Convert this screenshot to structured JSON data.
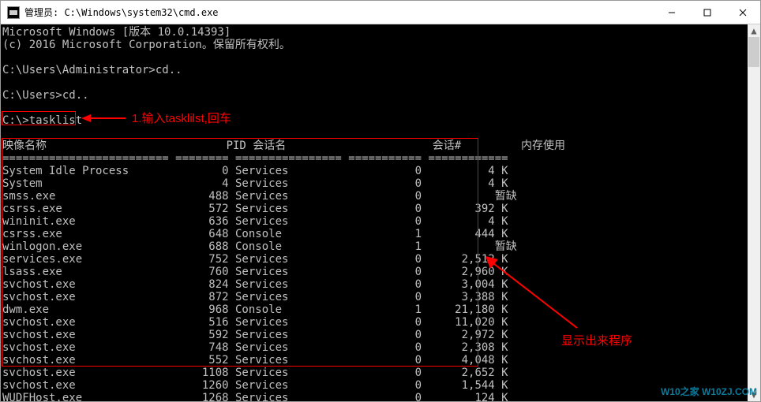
{
  "titlebar": {
    "title": "管理员: C:\\Windows\\system32\\cmd.exe"
  },
  "header_lines": [
    "Microsoft Windows [版本 10.0.14393]",
    "(c) 2016 Microsoft Corporation。保留所有权利。",
    "",
    "C:\\Users\\Administrator>cd..",
    "",
    "C:\\Users>cd..",
    "",
    "C:\\>tasklist",
    ""
  ],
  "table": {
    "headers": {
      "c1": "映像名称",
      "c2": "PID",
      "c3": "会话名",
      "c4": "会话#",
      "c5": "内存使用"
    },
    "sep": {
      "c1": "=========================",
      "c2": "========",
      "c3": "================",
      "c4": "===========",
      "c5": "============"
    },
    "rows": [
      {
        "name": "System Idle Process",
        "pid": "0",
        "sess": "Services",
        "sid": "0",
        "mem": "4 K"
      },
      {
        "name": "System",
        "pid": "4",
        "sess": "Services",
        "sid": "0",
        "mem": "4 K"
      },
      {
        "name": "smss.exe",
        "pid": "488",
        "sess": "Services",
        "sid": "0",
        "mem": "暂缺"
      },
      {
        "name": "csrss.exe",
        "pid": "572",
        "sess": "Services",
        "sid": "0",
        "mem": "392 K"
      },
      {
        "name": "wininit.exe",
        "pid": "636",
        "sess": "Services",
        "sid": "0",
        "mem": "4 K"
      },
      {
        "name": "csrss.exe",
        "pid": "648",
        "sess": "Console",
        "sid": "1",
        "mem": "444 K"
      },
      {
        "name": "winlogon.exe",
        "pid": "688",
        "sess": "Console",
        "sid": "1",
        "mem": "暂缺"
      },
      {
        "name": "services.exe",
        "pid": "752",
        "sess": "Services",
        "sid": "0",
        "mem": "2,512 K"
      },
      {
        "name": "lsass.exe",
        "pid": "760",
        "sess": "Services",
        "sid": "0",
        "mem": "2,960 K"
      },
      {
        "name": "svchost.exe",
        "pid": "824",
        "sess": "Services",
        "sid": "0",
        "mem": "3,004 K"
      },
      {
        "name": "svchost.exe",
        "pid": "872",
        "sess": "Services",
        "sid": "0",
        "mem": "3,388 K"
      },
      {
        "name": "dwm.exe",
        "pid": "968",
        "sess": "Console",
        "sid": "1",
        "mem": "21,180 K"
      },
      {
        "name": "svchost.exe",
        "pid": "516",
        "sess": "Services",
        "sid": "0",
        "mem": "11,020 K"
      },
      {
        "name": "svchost.exe",
        "pid": "592",
        "sess": "Services",
        "sid": "0",
        "mem": "2,972 K"
      },
      {
        "name": "svchost.exe",
        "pid": "748",
        "sess": "Services",
        "sid": "0",
        "mem": "2,308 K"
      },
      {
        "name": "svchost.exe",
        "pid": "552",
        "sess": "Services",
        "sid": "0",
        "mem": "4,048 K"
      },
      {
        "name": "svchost.exe",
        "pid": "1108",
        "sess": "Services",
        "sid": "0",
        "mem": "2,652 K"
      },
      {
        "name": "svchost.exe",
        "pid": "1260",
        "sess": "Services",
        "sid": "0",
        "mem": "1,544 K"
      },
      {
        "name": "WUDFHost.exe",
        "pid": "1268",
        "sess": "Services",
        "sid": "0",
        "mem": "124 K"
      }
    ]
  },
  "annotations": {
    "a1": "1.输入tasklilst,回车",
    "a2": "显示出来程序"
  },
  "watermark": "W10之家 W10ZJ.COM",
  "scroll_arrows": {
    "up": "▲",
    "down": "▼"
  }
}
